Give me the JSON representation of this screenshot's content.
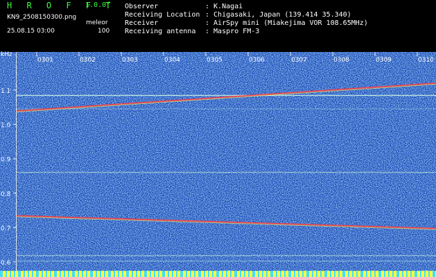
{
  "header": {
    "app_title": "H R O F F T",
    "version": "1.0.0f",
    "filename": "KN9_2508150300.png",
    "mode_label": "meleor",
    "datetime": "25.08.15 03:00",
    "mode_value": "100",
    "info": [
      {
        "key": "Observer",
        "value": ": K.Nagai"
      },
      {
        "key": "Receiving Location",
        "value": ": Chigasaki, Japan (139.414 35.340)"
      },
      {
        "key": "Receiver",
        "value": ": AirSpy mini (Miakejima VOR 108.65MHz)"
      },
      {
        "key": "Receiving antenna",
        "value": ": Maspro FM-3"
      }
    ]
  },
  "plot": {
    "y_unit": "kHz",
    "y_ticks": [
      "1.1",
      "1.0",
      "0.9",
      "0.8",
      "0.7",
      "0.6"
    ],
    "time_ticks": [
      "0301",
      "0302",
      "0303",
      "0304",
      "0305",
      "0306",
      "0307",
      "0308",
      "0309",
      "0310"
    ],
    "colors": {
      "background": "#1d3fb7",
      "noise_bright": "#5fd0ff",
      "trace": "#ff4040",
      "line": "#d8ffe0",
      "bottom_band": "#ffff40"
    }
  }
}
